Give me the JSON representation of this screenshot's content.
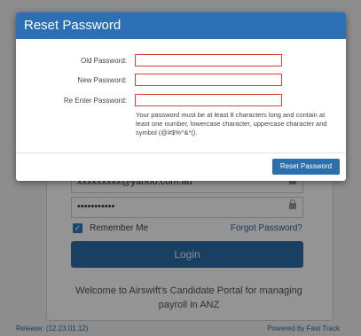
{
  "modal": {
    "title": "Reset Password",
    "old_password_label": "Old Password:",
    "new_password_label": "New Password:",
    "reenter_password_label": "Re Enter Password:",
    "old_password_value": "",
    "new_password_value": "",
    "reenter_password_value": "",
    "hint": "Your password must be at least 8 characters long and contain at least one number, lowercase character, uppercase character and symbol (@#$%^&*().",
    "reset_button": "Reset Password"
  },
  "login": {
    "username_value": "xxxxxxxxx@yahoo.com.au",
    "password_value": "•••••••••••",
    "remember_label": "Remember Me",
    "remember_checked": true,
    "forgot_link": "Forgot Password?",
    "login_button": "Login",
    "welcome_text": "Welcome to Airswift's Candidate Portal for managing payroll in ANZ"
  },
  "footer": {
    "release": "Release: (12.23.01.12)",
    "powered_by": "Powered by Fast Track"
  },
  "colors": {
    "primary": "#2c70b3",
    "error_border": "#d9413f"
  },
  "icons": {
    "lock": "lock-icon",
    "check": "check-icon"
  }
}
